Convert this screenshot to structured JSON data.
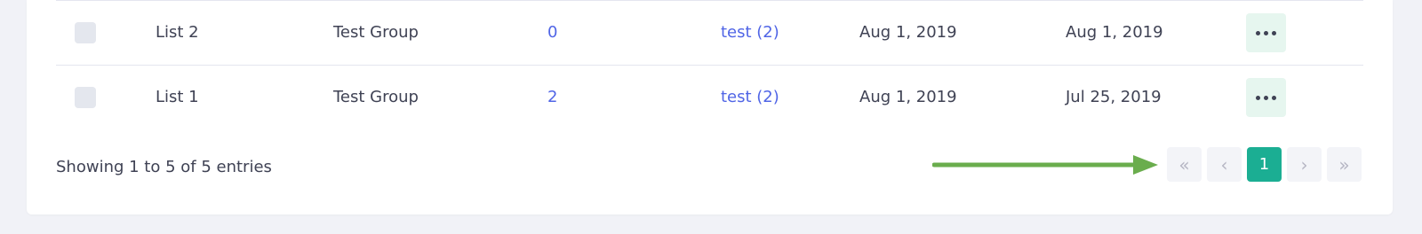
{
  "table": {
    "rows": [
      {
        "name": "List 2",
        "group": "Test Group",
        "count": "0",
        "segments": "test (2)",
        "date_created": "Aug 1, 2019",
        "date_updated": "Aug 1, 2019"
      },
      {
        "name": "List 1",
        "group": "Test Group",
        "count": "2",
        "segments": "test (2)",
        "date_created": "Aug 1, 2019",
        "date_updated": "Jul 25, 2019"
      }
    ]
  },
  "footer": {
    "showing_text": "Showing 1 to 5 of 5 entries"
  },
  "pagination": {
    "first_icon": "double-chevron-left-icon",
    "prev_icon": "chevron-left-icon",
    "current_page": "1",
    "next_icon": "chevron-right-icon",
    "last_icon": "double-chevron-right-icon",
    "active_color": "#1bae93"
  },
  "annotation": {
    "arrow_color": "#6aad4d"
  },
  "colors": {
    "link": "#5065e6",
    "action_button_bg": "#e6f6ef",
    "page_bg": "#f1f2f7"
  }
}
